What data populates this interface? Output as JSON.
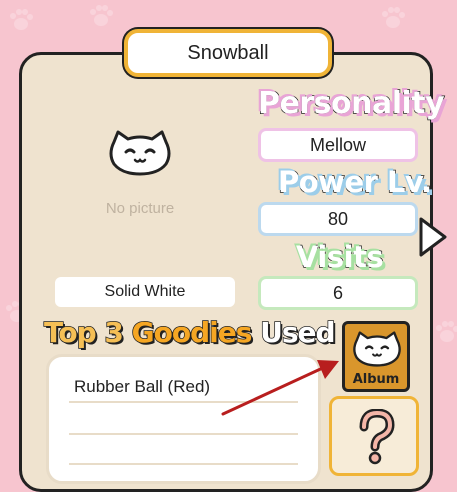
{
  "cat": {
    "name": "Snowball",
    "no_picture_text": "No picture",
    "pattern": "Solid White"
  },
  "personality": {
    "heading": "Personality",
    "value": "Mellow"
  },
  "power": {
    "heading": "Power Lv.",
    "value": "80"
  },
  "visits": {
    "heading": "Visits",
    "value": "6"
  },
  "goodies": {
    "heading_top": "Top 3",
    "heading_goodies": "Goodies",
    "heading_used": "Used",
    "items": [
      "Rubber Ball (Red)",
      "",
      ""
    ]
  },
  "album_button": {
    "label": "Album"
  },
  "icons": {
    "next": "chevron-right-icon",
    "album": "cat-face-icon",
    "mystery": "question-mark-icon",
    "annotation": "red-arrow-icon"
  },
  "colors": {
    "background": "#f7c5cf",
    "card": "#efe3cf",
    "accent": "#f0b437",
    "personality": "#e9a4d6",
    "power": "#9ccde9",
    "visits": "#a7e0a1",
    "annotation_arrow": "#b81e1e"
  }
}
